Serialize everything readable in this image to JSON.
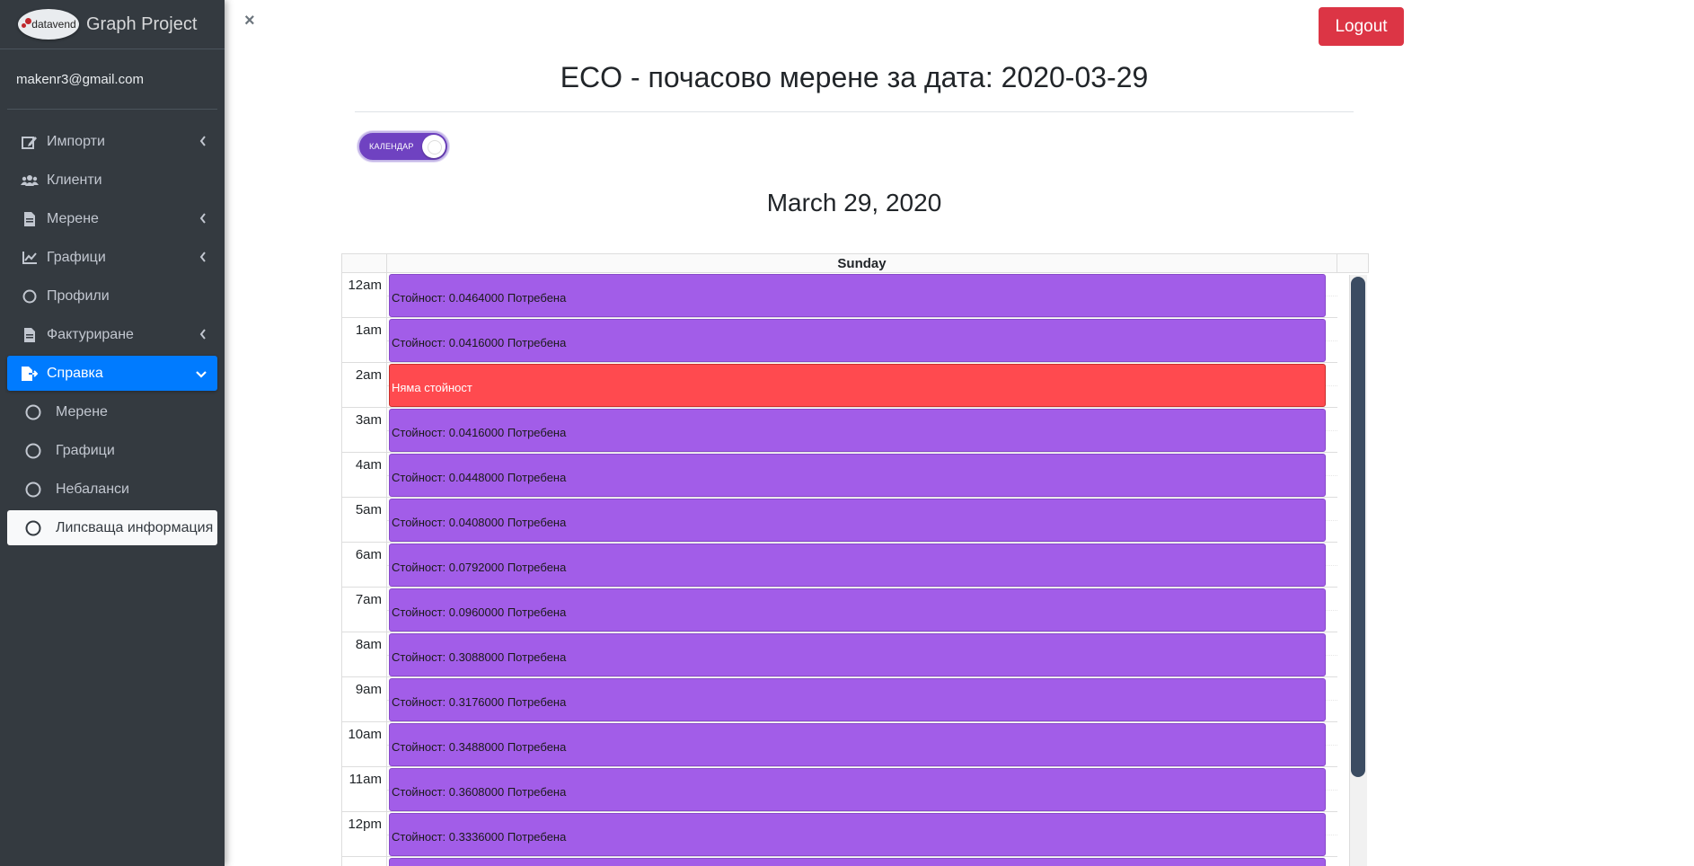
{
  "brand": {
    "logo_text": "datavend",
    "title": "Graph Project"
  },
  "user": {
    "email": "makenr3@gmail.com"
  },
  "sidebar": {
    "items": [
      {
        "label": "Импорти",
        "icon": "edit-icon",
        "caret": "‹"
      },
      {
        "label": "Клиенти",
        "icon": "users-icon",
        "caret": ""
      },
      {
        "label": "Мерене",
        "icon": "file-icon",
        "caret": "‹"
      },
      {
        "label": "Графици",
        "icon": "line-chart-icon",
        "caret": "‹"
      },
      {
        "label": "Профили",
        "icon": "circle-icon",
        "caret": ""
      },
      {
        "label": "Фактуриране",
        "icon": "file-icon",
        "caret": "‹"
      },
      {
        "label": "Справка",
        "icon": "file-export-icon",
        "caret": "⌄"
      }
    ],
    "subitems": [
      {
        "label": "Мерене"
      },
      {
        "label": "Графици"
      },
      {
        "label": "Небаланси"
      },
      {
        "label": "Липсваща информация"
      }
    ]
  },
  "header": {
    "close_label": "×",
    "logout_label": "Logout"
  },
  "page": {
    "title": "ECO - почасово мерене за дата: 2020-03-29"
  },
  "toggle": {
    "label": "КАЛЕНДАР",
    "state": "on"
  },
  "calendar": {
    "date_heading": "March 29, 2020",
    "day_label": "Sunday",
    "slots": [
      {
        "time": "12am",
        "event": "Стойност: 0.0464000 Потребена",
        "status": "ok"
      },
      {
        "time": "1am",
        "event": "Стойност: 0.0416000 Потребена",
        "status": "ok"
      },
      {
        "time": "2am",
        "event": "Няма стойност",
        "status": "missing"
      },
      {
        "time": "3am",
        "event": "Стойност: 0.0416000 Потребена",
        "status": "ok"
      },
      {
        "time": "4am",
        "event": "Стойност: 0.0448000 Потребена",
        "status": "ok"
      },
      {
        "time": "5am",
        "event": "Стойност: 0.0408000 Потребена",
        "status": "ok"
      },
      {
        "time": "6am",
        "event": "Стойност: 0.0792000 Потребена",
        "status": "ok"
      },
      {
        "time": "7am",
        "event": "Стойност: 0.0960000 Потребена",
        "status": "ok"
      },
      {
        "time": "8am",
        "event": "Стойност: 0.3088000 Потребена",
        "status": "ok"
      },
      {
        "time": "9am",
        "event": "Стойност: 0.3176000 Потребена",
        "status": "ok"
      },
      {
        "time": "10am",
        "event": "Стойност: 0.3488000 Потребена",
        "status": "ok"
      },
      {
        "time": "11am",
        "event": "Стойност: 0.3608000 Потребена",
        "status": "ok"
      },
      {
        "time": "12pm",
        "event": "Стойност: 0.3336000 Потребена",
        "status": "ok"
      },
      {
        "time": "",
        "event": "",
        "status": "ok"
      }
    ]
  },
  "colors": {
    "sidebar_bg": "#343a40",
    "active_item": "#007bff",
    "logout": "#dc3545",
    "event_ok": "#a25de8",
    "event_missing": "#ff4a4f",
    "toggle": "#6f42c1",
    "scrollbar": "#3b4c62"
  }
}
